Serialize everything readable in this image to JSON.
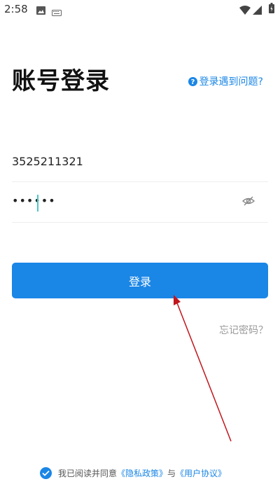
{
  "status_bar": {
    "time": "2:58",
    "icons": [
      "image-icon",
      "keyboard-icon",
      "wifi-icon",
      "signal-icon",
      "battery-icon"
    ]
  },
  "login": {
    "title": "账号登录",
    "help_link": "登录遇到问题?",
    "phone_value": "3525211321",
    "password_value": "••••••",
    "login_button": "登录",
    "forgot_password": "忘记密码？"
  },
  "agreement": {
    "checked": true,
    "prefix": "我已阅读并同意",
    "privacy_link": "《隐私政策》",
    "joiner": "与",
    "terms_link": "《用户协议》"
  },
  "colors": {
    "accent": "#1a86e6",
    "caret": "#4cc6c6",
    "annotation": "#c0161c"
  }
}
